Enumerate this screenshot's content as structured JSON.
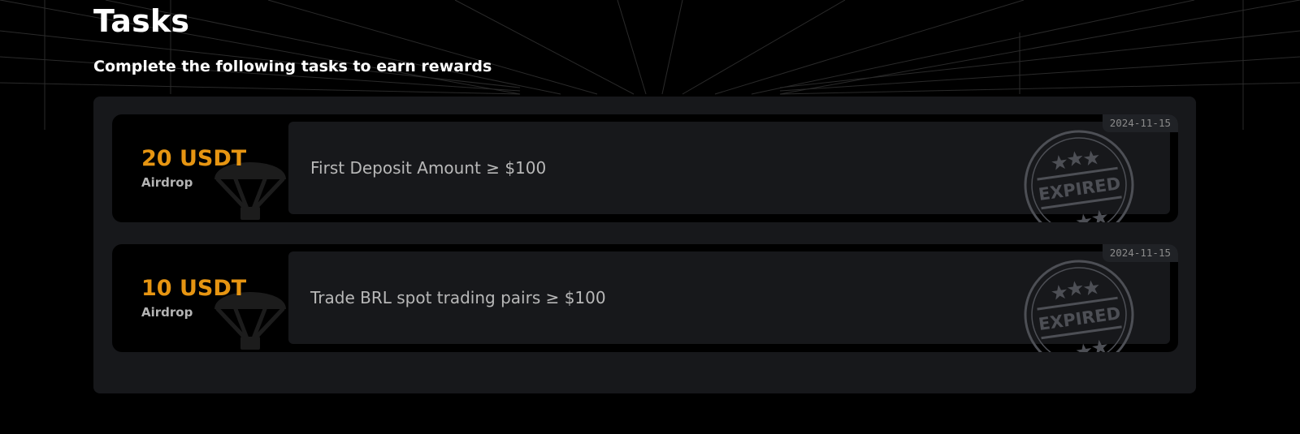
{
  "page": {
    "title": "Tasks",
    "subtitle": "Complete the following tasks to earn rewards"
  },
  "colors": {
    "background": "#000000",
    "panel": "#17181b",
    "reward_accent": "#e69512",
    "stamp": "#4d4f55"
  },
  "tasks": [
    {
      "reward_amount": "20 USDT",
      "reward_type": "Airdrop",
      "description": "First Deposit Amount ≥ $100",
      "date": "2024-11-15",
      "stamp": "EXPIRED",
      "reward_icon": "parachute-icon"
    },
    {
      "reward_amount": "10 USDT",
      "reward_type": "Airdrop",
      "description": "Trade BRL spot trading pairs ≥ $100",
      "date": "2024-11-15",
      "stamp": "EXPIRED",
      "reward_icon": "parachute-icon"
    }
  ]
}
